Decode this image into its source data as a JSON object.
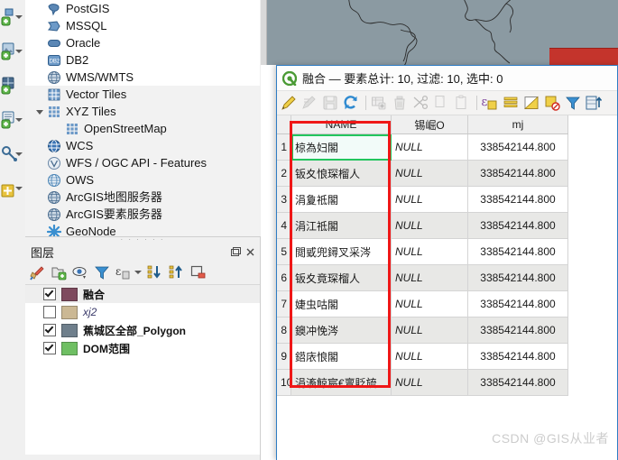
{
  "app": {
    "name": "QGIS",
    "accent": "#2f7dc4",
    "map_background": "#8b9aa2",
    "annotation_color": "#ef1717",
    "active_cell_color": "#22c55e"
  },
  "vertical_toolbar": {
    "items": [
      {
        "name": "add-vector-layer",
        "has_dropdown": true
      },
      {
        "name": "add-raster-layer",
        "has_dropdown": true
      },
      {
        "name": "add-mesh-layer",
        "has_dropdown": false
      },
      {
        "name": "add-delimited-text-layer",
        "has_dropdown": true
      },
      {
        "name": "add-postgis-layer",
        "has_dropdown": false
      },
      {
        "name": "add-wms-layer",
        "has_dropdown": true
      }
    ]
  },
  "browser": {
    "items": [
      {
        "label": "PostGIS",
        "icon": "postgis-icon",
        "indent": 0,
        "shaded": false,
        "expanded": null
      },
      {
        "label": "MSSQL",
        "icon": "mssql-icon",
        "indent": 0,
        "shaded": false,
        "expanded": null
      },
      {
        "label": "Oracle",
        "icon": "oracle-icon",
        "indent": 0,
        "shaded": false,
        "expanded": null
      },
      {
        "label": "DB2",
        "icon": "db2-icon",
        "indent": 0,
        "shaded": false,
        "expanded": null
      },
      {
        "label": "WMS/WMTS",
        "icon": "globe-icon",
        "indent": 0,
        "shaded": false,
        "expanded": null
      },
      {
        "label": "Vector Tiles",
        "icon": "vector-tiles-icon",
        "indent": 0,
        "shaded": true,
        "expanded": null
      },
      {
        "label": "XYZ Tiles",
        "icon": "xyz-tiles-icon",
        "indent": 0,
        "shaded": true,
        "expanded": true
      },
      {
        "label": "OpenStreetMap",
        "icon": "xyz-tiles-icon",
        "indent": 1,
        "shaded": true,
        "expanded": null
      },
      {
        "label": "WCS",
        "icon": "wcs-icon",
        "indent": 0,
        "shaded": true,
        "expanded": null
      },
      {
        "label": "WFS / OGC API - Features",
        "icon": "wfs-icon",
        "indent": 0,
        "shaded": true,
        "expanded": null
      },
      {
        "label": "OWS",
        "icon": "ows-icon",
        "indent": 0,
        "shaded": true,
        "expanded": null
      },
      {
        "label": "ArcGIS地图服务器",
        "icon": "arcgis-map-icon",
        "indent": 0,
        "shaded": true,
        "expanded": null
      },
      {
        "label": "ArcGIS要素服务器",
        "icon": "arcgis-feature-icon",
        "indent": 0,
        "shaded": true,
        "expanded": null
      },
      {
        "label": "GeoNode",
        "icon": "geonode-icon",
        "indent": 0,
        "shaded": true,
        "expanded": null
      }
    ]
  },
  "layers_panel": {
    "title": "图层",
    "toolbar": [
      {
        "name": "open-layer-styling-panel",
        "icon": "paintbrush-icon"
      },
      {
        "name": "add-group",
        "icon": "add-group-icon"
      },
      {
        "name": "manage-map-themes",
        "icon": "eye-icon"
      },
      {
        "name": "filter-legend",
        "icon": "filter-icon"
      },
      {
        "name": "filter-legend-expression",
        "icon": "expression-icon",
        "has_dropdown": true
      },
      {
        "name": "expand-all",
        "icon": "expand-all-icon"
      },
      {
        "name": "collapse-all",
        "icon": "collapse-all-icon"
      },
      {
        "name": "remove-layer",
        "icon": "remove-layer-icon"
      }
    ],
    "layers": [
      {
        "name": "融合",
        "checked": true,
        "color": "#7e4a5e",
        "bold": true,
        "italic": false,
        "selected": true
      },
      {
        "name": "xj2",
        "checked": false,
        "color": "#cbb894",
        "bold": false,
        "italic": true,
        "selected": false
      },
      {
        "name": "蕉城区全部_Polygon",
        "checked": true,
        "color": "#6f7f8c",
        "bold": true,
        "italic": false,
        "selected": false
      },
      {
        "name": "DOM范围",
        "checked": true,
        "color": "#6fbf63",
        "bold": true,
        "italic": false,
        "selected": false
      }
    ]
  },
  "attribute_table": {
    "title": "融合 — 要素总计: 10, 过滤: 10, 选中: 0",
    "logo": "qgis-logo-icon",
    "toolbar": [
      {
        "name": "toggle-editing",
        "icon": "pencil-icon",
        "enabled": true
      },
      {
        "name": "save-edits",
        "icon": "save-edits-icon",
        "enabled": false
      },
      {
        "name": "save-layer-edits",
        "icon": "floppy-icon",
        "enabled": false
      },
      {
        "name": "reload-table",
        "icon": "refresh-icon",
        "enabled": true
      },
      {
        "name": "separator-1",
        "icon": "separator",
        "enabled": true
      },
      {
        "name": "add-feature",
        "icon": "add-feature-icon",
        "enabled": false
      },
      {
        "name": "delete-selected-features",
        "icon": "trash-icon",
        "enabled": false
      },
      {
        "name": "cut-features",
        "icon": "scissors-icon",
        "enabled": false
      },
      {
        "name": "copy-features",
        "icon": "copy-icon",
        "enabled": false
      },
      {
        "name": "paste-features",
        "icon": "paste-icon",
        "enabled": false
      },
      {
        "name": "separator-2",
        "icon": "separator",
        "enabled": true
      },
      {
        "name": "select-by-expression",
        "icon": "expression-select-icon",
        "enabled": true
      },
      {
        "name": "select-all",
        "icon": "select-all-icon",
        "enabled": true
      },
      {
        "name": "invert-selection",
        "icon": "invert-selection-icon",
        "enabled": true
      },
      {
        "name": "deselect-all",
        "icon": "deselect-all-icon",
        "enabled": true
      },
      {
        "name": "filter-features",
        "icon": "funnel-icon",
        "enabled": true
      },
      {
        "name": "move-selection-to-top",
        "icon": "move-top-icon",
        "enabled": true
      }
    ],
    "columns": [
      {
        "key": "name",
        "label": "NAME"
      },
      {
        "key": "null",
        "label": "锡崛O"
      },
      {
        "key": "mj",
        "label": "mj"
      }
    ],
    "rows": [
      {
        "index": "1",
        "name": "椋為妇閣",
        "null": "NULL",
        "mj": "338542144.800",
        "active": true
      },
      {
        "index": "2",
        "name": "钣夊悢琛榴人",
        "null": "NULL",
        "mj": "338542144.800",
        "active": false
      },
      {
        "index": "3",
        "name": "涓夐祗閣",
        "null": "NULL",
        "mj": "338542144.800",
        "active": false
      },
      {
        "index": "4",
        "name": "涓江祗閣",
        "null": "NULL",
        "mj": "338542144.800",
        "active": false
      },
      {
        "index": "5",
        "name": "閲戜兜鐞叉采涔",
        "null": "NULL",
        "mj": "338542144.800",
        "active": false
      },
      {
        "index": "6",
        "name": "钣夊竟琛榴人",
        "null": "NULL",
        "mj": "338542144.800",
        "active": false
      },
      {
        "index": "7",
        "name": "婕虫咕閣",
        "null": "NULL",
        "mj": "338542144.800",
        "active": false
      },
      {
        "index": "8",
        "name": "鐭冲悗涔",
        "null": "NULL",
        "mj": "338542144.800",
        "active": false
      },
      {
        "index": "9",
        "name": "鍣庡悢閣",
        "null": "NULL",
        "mj": "338542144.800",
        "active": false
      },
      {
        "index": "10",
        "name": "涓滀鲸宸€亶貶旈",
        "null": "NULL",
        "mj": "338542144.800",
        "active": false
      }
    ]
  },
  "watermark": {
    "text": "CSDN @GIS从业者"
  }
}
